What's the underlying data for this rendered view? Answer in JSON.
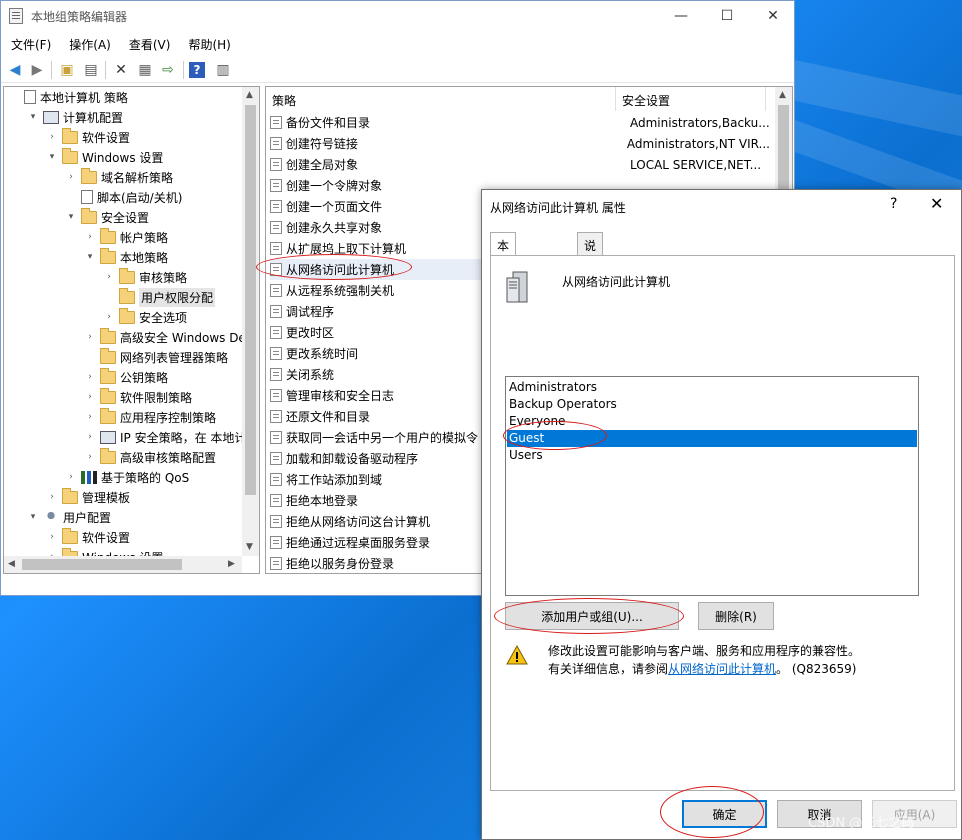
{
  "window": {
    "title": "本地组策略编辑器",
    "minimize": "—",
    "maximize": "☐",
    "close": "✕"
  },
  "menu": [
    "文件(F)",
    "操作(A)",
    "查看(V)",
    "帮助(H)"
  ],
  "tree": {
    "items": [
      {
        "label": "本地计算机 策略",
        "icon": "doc-icon",
        "level": 0,
        "expand": ""
      },
      {
        "label": "计算机配置",
        "icon": "computer-icon",
        "level": 1,
        "expand": "▾"
      },
      {
        "label": "软件设置",
        "icon": "folder-icon",
        "level": 2,
        "expand": "›"
      },
      {
        "label": "Windows 设置",
        "icon": "folder-icon",
        "level": 2,
        "expand": "▾"
      },
      {
        "label": "域名解析策略",
        "icon": "folder-icon",
        "level": 3,
        "expand": "›"
      },
      {
        "label": "脚本(启动/关机)",
        "icon": "script-icon",
        "level": 3,
        "expand": ""
      },
      {
        "label": "安全设置",
        "icon": "security-folder-icon",
        "level": 3,
        "expand": "▾"
      },
      {
        "label": "帐户策略",
        "icon": "folder-icon",
        "level": 4,
        "expand": "›"
      },
      {
        "label": "本地策略",
        "icon": "folder-icon",
        "level": 4,
        "expand": "▾"
      },
      {
        "label": "审核策略",
        "icon": "folder-icon",
        "level": 5,
        "expand": "›"
      },
      {
        "label": "用户权限分配",
        "icon": "folder-icon",
        "level": 5,
        "expand": "",
        "selected": true
      },
      {
        "label": "安全选项",
        "icon": "folder-icon",
        "level": 5,
        "expand": "›"
      },
      {
        "label": "高级安全 Windows Defe",
        "icon": "folder-icon",
        "level": 4,
        "expand": "›"
      },
      {
        "label": "网络列表管理器策略",
        "icon": "folder-icon",
        "level": 4,
        "expand": ""
      },
      {
        "label": "公钥策略",
        "icon": "folder-icon",
        "level": 4,
        "expand": "›"
      },
      {
        "label": "软件限制策略",
        "icon": "folder-icon",
        "level": 4,
        "expand": "›"
      },
      {
        "label": "应用程序控制策略",
        "icon": "folder-icon",
        "level": 4,
        "expand": "›"
      },
      {
        "label": "IP 安全策略，在 本地计算",
        "icon": "computer-icon",
        "level": 4,
        "expand": "›"
      },
      {
        "label": "高级审核策略配置",
        "icon": "folder-icon",
        "level": 4,
        "expand": "›"
      },
      {
        "label": "基于策略的 QoS",
        "icon": "chart-icon",
        "level": 3,
        "expand": "›"
      },
      {
        "label": "管理模板",
        "icon": "folder-icon",
        "level": 2,
        "expand": "›"
      },
      {
        "label": "用户配置",
        "icon": "user-icon",
        "level": 1,
        "expand": "▾"
      },
      {
        "label": "软件设置",
        "icon": "folder-icon",
        "level": 2,
        "expand": "›"
      },
      {
        "label": "Windows 设置",
        "icon": "folder-icon",
        "level": 2,
        "expand": "›"
      }
    ]
  },
  "list": {
    "col_policy": "策略",
    "col_setting": "安全设置",
    "rows": [
      {
        "name": "备份文件和目录",
        "value": "Administrators,Backu..."
      },
      {
        "name": "创建符号链接",
        "value": "Administrators,NT VIR..."
      },
      {
        "name": "创建全局对象",
        "value": "LOCAL SERVICE,NET..."
      },
      {
        "name": "创建一个令牌对象",
        "value": ""
      },
      {
        "name": "创建一个页面文件",
        "value": ""
      },
      {
        "name": "创建永久共享对象",
        "value": ""
      },
      {
        "name": "从扩展坞上取下计算机",
        "value": ""
      },
      {
        "name": "从网络访问此计算机",
        "value": "",
        "highlight": true
      },
      {
        "name": "从远程系统强制关机",
        "value": ""
      },
      {
        "name": "调试程序",
        "value": ""
      },
      {
        "name": "更改时区",
        "value": ""
      },
      {
        "name": "更改系统时间",
        "value": ""
      },
      {
        "name": "关闭系统",
        "value": ""
      },
      {
        "name": "管理审核和安全日志",
        "value": ""
      },
      {
        "name": "还原文件和目录",
        "value": ""
      },
      {
        "name": "获取同一会话中另一个用户的模拟令",
        "value": ""
      },
      {
        "name": "加载和卸载设备驱动程序",
        "value": ""
      },
      {
        "name": "将工作站添加到域",
        "value": ""
      },
      {
        "name": "拒绝本地登录",
        "value": ""
      },
      {
        "name": "拒绝从网络访问这台计算机",
        "value": ""
      },
      {
        "name": "拒绝通过远程桌面服务登录",
        "value": ""
      },
      {
        "name": "拒绝以服务身份登录",
        "value": ""
      }
    ]
  },
  "dialog": {
    "title": "从网络访问此计算机 属性",
    "help": "?",
    "close": "✕",
    "tab_local": "本地安全设置",
    "tab_explain": "说明",
    "policy_name": "从网络访问此计算机",
    "members": [
      {
        "name": "Administrators",
        "selected": false
      },
      {
        "name": "Backup Operators",
        "selected": false
      },
      {
        "name": "Everyone",
        "selected": false
      },
      {
        "name": "Guest",
        "selected": true
      },
      {
        "name": "Users",
        "selected": false
      }
    ],
    "add_button": "添加用户或组(U)...",
    "remove_button": "删除(R)",
    "warning_line1": "修改此设置可能影响与客户端、服务和应用程序的兼容性。",
    "warning_line2_prefix": "有关详细信息，请参阅",
    "warning_link": "从网络访问此计算机",
    "warning_line2_suffix": "。 (Q823659)",
    "ok_button": "确定",
    "cancel_button": "取消",
    "apply_button": "应用(A)"
  },
  "watermark": "CSDN @三七之码"
}
